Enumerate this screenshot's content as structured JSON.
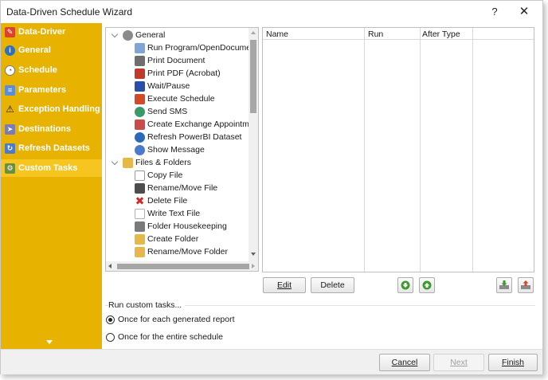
{
  "window": {
    "title": "Data-Driven Schedule Wizard",
    "help": "?",
    "close": "✕"
  },
  "sidebar": {
    "items": [
      {
        "label": "Data-Driver",
        "icon": "data-driver-icon",
        "color": "#d9442b"
      },
      {
        "label": "General",
        "icon": "info-icon",
        "color": "#2f6fbf"
      },
      {
        "label": "Schedule",
        "icon": "clock-icon",
        "color": "#7a7a7a"
      },
      {
        "label": "Parameters",
        "icon": "parameters-icon",
        "color": "#5a8fd8"
      },
      {
        "label": "Exception Handling",
        "icon": "warning-icon",
        "color": "#1a1a1a"
      },
      {
        "label": "Destinations",
        "icon": "destinations-icon",
        "color": "#7b7bb5"
      },
      {
        "label": "Refresh Datasets",
        "icon": "refresh-datasets-icon",
        "color": "#4a7ac9"
      },
      {
        "label": "Custom Tasks",
        "icon": "custom-tasks-icon",
        "color": "#6b8f3a"
      }
    ]
  },
  "tree": {
    "items": [
      {
        "label": "General",
        "icon": "gear-icon",
        "level": 0,
        "color": "#8a8a8a"
      },
      {
        "label": "Run Program/OpenDocument",
        "icon": "run-program-icon",
        "level": 1,
        "color": "#7da6d6"
      },
      {
        "label": "Print Document",
        "icon": "printer-icon",
        "level": 1,
        "color": "#6e6e6e"
      },
      {
        "label": "Print PDF (Acrobat)",
        "icon": "print-pdf-icon",
        "level": 1,
        "color": "#c0392b"
      },
      {
        "label": "Wait/Pause",
        "icon": "pause-icon",
        "level": 1,
        "color": "#2a4fa8"
      },
      {
        "label": "Execute Schedule",
        "icon": "execute-schedule-icon",
        "level": 1,
        "color": "#d24a2a"
      },
      {
        "label": "Send SMS",
        "icon": "sms-icon",
        "level": 1,
        "color": "#3a9a6a"
      },
      {
        "label": "Create Exchange Appointment",
        "icon": "calendar-icon",
        "level": 1,
        "color": "#c94c4c"
      },
      {
        "label": "Refresh PowerBI Dataset",
        "icon": "refresh-icon",
        "level": 1,
        "color": "#2a6ab8"
      },
      {
        "label": "Show Message",
        "icon": "info-icon",
        "level": 1,
        "color": "#4a7ac9"
      },
      {
        "label": "Files & Folders",
        "icon": "folder-icon",
        "level": 0,
        "color": "#e6b84a"
      },
      {
        "label": "Copy File",
        "icon": "copy-file-icon",
        "level": 1,
        "color": "#9a9a9a"
      },
      {
        "label": "Rename/Move File",
        "icon": "rename-file-icon",
        "level": 1,
        "color": "#4d4d4d"
      },
      {
        "label": "Delete File",
        "icon": "delete-icon",
        "level": 1,
        "color": "#d22a2a"
      },
      {
        "label": "Write Text File",
        "icon": "write-text-icon",
        "level": 1,
        "color": "#b0b0b0"
      },
      {
        "label": "Folder Housekeeping",
        "icon": "housekeeping-icon",
        "level": 1,
        "color": "#7a7a7a"
      },
      {
        "label": "Create Folder",
        "icon": "create-folder-icon",
        "level": 1,
        "color": "#e6b84a"
      },
      {
        "label": "Rename/Move Folder",
        "icon": "rename-folder-icon",
        "level": 1,
        "color": "#e6b84a"
      }
    ]
  },
  "grid": {
    "columns": [
      "Name",
      "Run",
      "After Type"
    ]
  },
  "actions": {
    "edit": "Edit",
    "delete": "Delete"
  },
  "run_tasks": {
    "label": "Run custom tasks...",
    "options": [
      {
        "label": "Once for each generated report",
        "checked": true
      },
      {
        "label": "Once for the entire schedule",
        "checked": false
      }
    ]
  },
  "footer": {
    "cancel": "Cancel",
    "next": "Next",
    "finish": "Finish"
  },
  "colors": {
    "sidebar": "#e8b300",
    "sidebar_active": "#f6c51f",
    "arrow_green": "#3a9a2a"
  }
}
